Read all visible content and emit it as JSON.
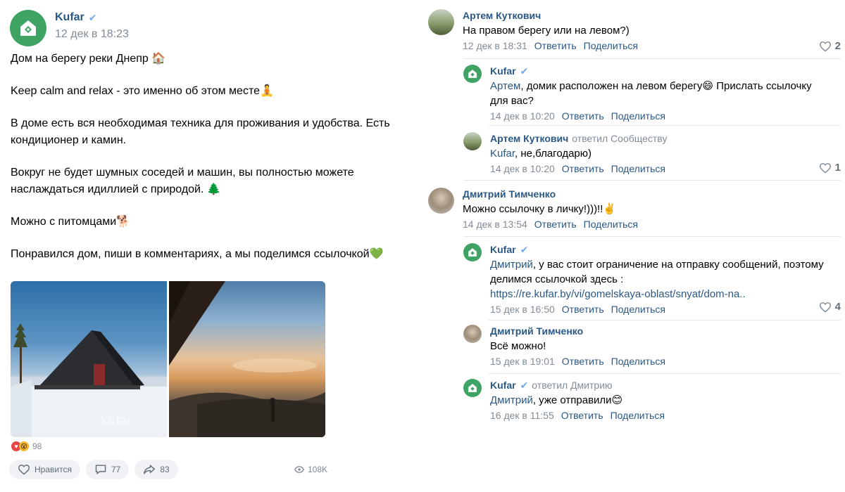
{
  "post": {
    "author": "Kufar",
    "date": "12 дек в 18:23",
    "paragraphs": [
      "Дом на берегу реки Днепр 🏠",
      "Keep calm and relax - это именно об этом месте🧘",
      "В доме есть вся необходимая техника для проживания и удобства. Есть кондиционер и камин.",
      "Вокруг не будет шумных соседей и машин, вы полностью можете наслаждаться идиллией с природой. 🌲",
      "Можно с питомцами🐕",
      "Понравился дом, пиши в комментариях, а мы поделимся ссылочкой💚"
    ],
    "photo_watermark": "kufar",
    "reactions_count": "98",
    "like_label": "Нравится",
    "comments_count": "77",
    "shares_count": "83",
    "views_count": "108K"
  },
  "comments": [
    {
      "author": "Артем Куткович",
      "text": "На правом берегу или на левом?)",
      "date": "12 дек в 18:31",
      "reply_label": "Ответить",
      "share_label": "Поделиться",
      "likes": "2"
    },
    {
      "author": "Kufar",
      "mention": "Артем",
      "text": ", домик расположен на левом берегу😄 Прислать ссылочку для вас?",
      "date": "14 дек в 10:20",
      "reply_label": "Ответить",
      "share_label": "Поделиться"
    },
    {
      "author": "Артем Куткович",
      "replied_to": "ответил Сообществу",
      "mention": "Kufar",
      "text": ", не,благодарю)",
      "date": "14 дек в 10:20",
      "reply_label": "Ответить",
      "share_label": "Поделиться",
      "likes": "1"
    },
    {
      "author": "Дмитрий Тимченко",
      "text": "Можно ссылочку в личку!)))!!✌️",
      "date": "14 дек в 13:54",
      "reply_label": "Ответить",
      "share_label": "Поделиться"
    },
    {
      "author": "Kufar",
      "mention": "Дмитрий",
      "text": ", у вас стоит ограничение на отправку сообщений, поэтому делимся ссылочкой здесь :",
      "link": "https://re.kufar.by/vi/gomelskaya-oblast/snyat/dom-na..",
      "date": "15 дек в 16:50",
      "reply_label": "Ответить",
      "share_label": "Поделиться",
      "likes": "4"
    },
    {
      "author": "Дмитрий Тимченко",
      "text": "Всё можно!",
      "date": "15 дек в 19:01",
      "reply_label": "Ответить",
      "share_label": "Поделиться"
    },
    {
      "author": "Kufar",
      "replied_to": "ответил Дмитрию",
      "mention": "Дмитрий",
      "text": ", уже отправили😊",
      "date": "16 дек в 11:55",
      "reply_label": "Ответить",
      "share_label": "Поделиться"
    }
  ],
  "icons": {
    "verified": "verified-check-icon",
    "like": "heart-icon",
    "comment": "comment-icon",
    "share": "share-arrow-icon",
    "views": "eye-icon",
    "kufar_logo": "kufar-house-logo"
  },
  "colors": {
    "brand_green": "#3fa363",
    "link_blue": "#2a5885",
    "meta_gray": "#818c99",
    "verified_blue": "#71aaeb"
  }
}
